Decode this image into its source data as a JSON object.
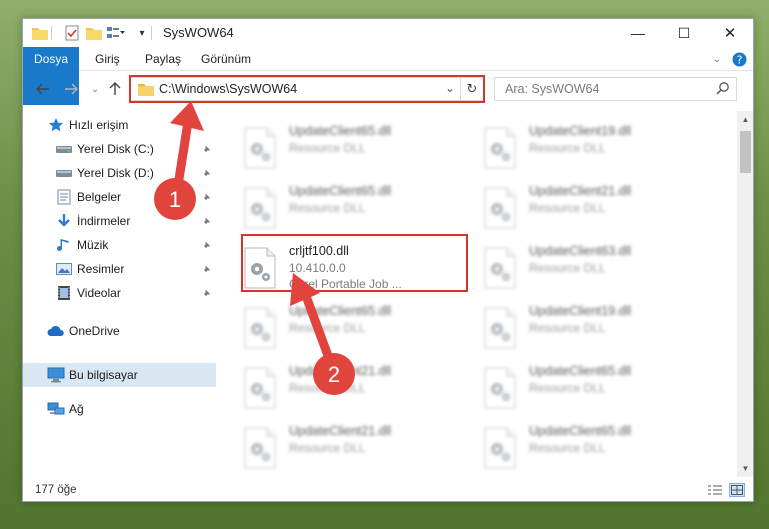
{
  "window": {
    "title": "SysWOW64"
  },
  "ribbon": {
    "tabs": [
      "Dosya",
      "Giriş",
      "Paylaş",
      "Görünüm"
    ]
  },
  "address": {
    "path": "C:\\Windows\\SysWOW64"
  },
  "search": {
    "placeholder": "Ara: SysWOW64"
  },
  "sidebar": {
    "items": [
      {
        "label": "Hızlı erişim",
        "icon": "star-icon"
      },
      {
        "label": "Yerel Disk (C:)",
        "icon": "drive-icon"
      },
      {
        "label": "Yerel Disk (D:)",
        "icon": "drive-icon"
      },
      {
        "label": "Belgeler",
        "icon": "documents-icon"
      },
      {
        "label": "İndirmeler",
        "icon": "download-icon"
      },
      {
        "label": "Müzik",
        "icon": "music-icon"
      },
      {
        "label": "Resimler",
        "icon": "pictures-icon"
      },
      {
        "label": "Videolar",
        "icon": "video-icon"
      },
      {
        "label": "OneDrive",
        "icon": "cloud-icon"
      },
      {
        "label": "Bu bilgisayar",
        "icon": "computer-icon"
      },
      {
        "label": "Ağ",
        "icon": "network-icon"
      }
    ]
  },
  "files": [
    {
      "name": "UpdateClient65.dll",
      "desc": "Resource DLL"
    },
    {
      "name": "UpdateClient19.dll",
      "desc": "Resource DLL"
    },
    {
      "name": "UpdateClient65.dll",
      "desc": "Resource DLL"
    },
    {
      "name": "UpdateClient21.dll",
      "desc": "Resource DLL"
    },
    {
      "name": "crljtf100.dll",
      "desc": "10.410.0.0",
      "desc2": "Corel Portable Job ..."
    },
    {
      "name": "UpdateClient63.dll",
      "desc": "Resource DLL"
    },
    {
      "name": "UpdateClient65.dll",
      "desc": "Resource DLL"
    },
    {
      "name": "UpdateClient19.dll",
      "desc": "Resource DLL"
    },
    {
      "name": "UpdateClient21.dll",
      "desc": "Resource DLL"
    },
    {
      "name": "UpdateClient65.dll",
      "desc": "Resource DLL"
    },
    {
      "name": "UpdateClient21.dll",
      "desc": "Resource DLL"
    },
    {
      "name": "UpdateClient65.dll",
      "desc": "Resource DLL"
    }
  ],
  "status": {
    "count": "177 öğe"
  },
  "annotations": {
    "badge1": "1",
    "badge2": "2",
    "color": "#e0443d"
  },
  "colors": {
    "accent": "#1979ca",
    "highlight": "#d6352e"
  }
}
